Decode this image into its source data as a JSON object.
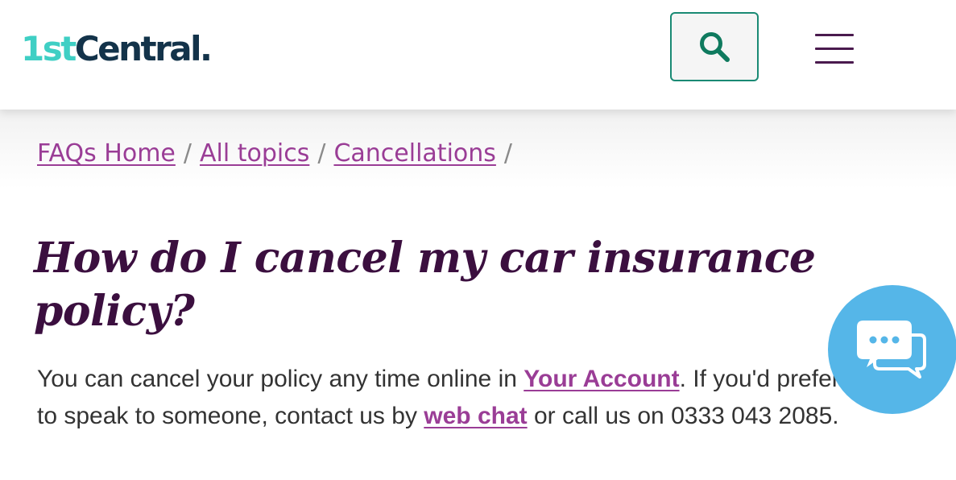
{
  "header": {
    "logo": {
      "part1": "1st",
      "part2": "Central."
    },
    "search_icon": "search-icon",
    "menu_icon": "hamburger-menu-icon"
  },
  "breadcrumb": {
    "items": [
      {
        "label": "FAQs Home"
      },
      {
        "label": "All topics"
      },
      {
        "label": "Cancellations"
      }
    ],
    "separator": "/"
  },
  "article": {
    "title": "How do I cancel my car insurance policy?",
    "body": {
      "t1": "You can cancel your policy any time online in ",
      "link1": "Your Account",
      "t2": ". If you'd prefer to speak to someone, contact us by ",
      "link2": "web chat",
      "t3": " or call us on 0333 043 2085."
    }
  },
  "chat": {
    "icon": "chat-bubbles-icon"
  },
  "colors": {
    "logo_teal": "#3fcfc4",
    "logo_navy": "#13334a",
    "title_purple": "#3b0f3f",
    "link_purple": "#9a3d96",
    "search_border": "#1a8a74",
    "chat_blue": "#55b6e8"
  }
}
